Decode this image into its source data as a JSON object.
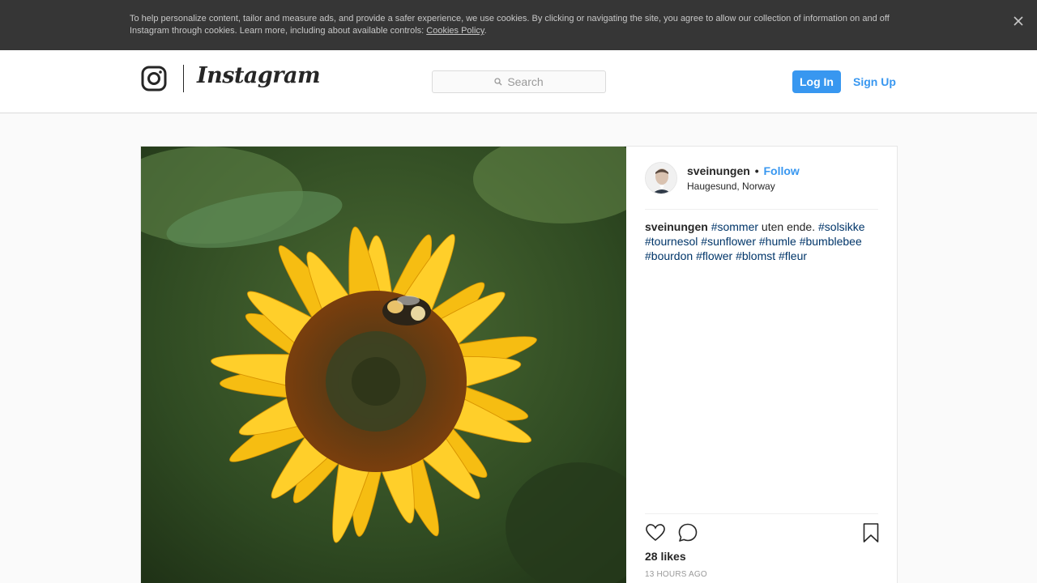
{
  "cookie_banner": {
    "text": "To help personalize content, tailor and measure ads, and provide a safer experience, we use cookies. By clicking or navigating the site, you agree to allow our collection of information on and off Instagram through cookies. Learn more, including about available controls: ",
    "link_label": "Cookies Policy",
    "link_suffix": ".",
    "close_icon": "close-icon"
  },
  "header": {
    "logo_icon": "instagram-camera-icon",
    "wordmark": "Instagram",
    "search_placeholder": "Search",
    "search_icon": "search-icon",
    "login_label": "Log In",
    "signup_label": "Sign Up"
  },
  "post": {
    "username": "sveinungen",
    "separator": "•",
    "follow_label": "Follow",
    "location": "Haugesund, Norway",
    "caption": {
      "username": "sveinungen",
      "parts": [
        {
          "type": "tag",
          "text": "#sommer"
        },
        {
          "type": "text",
          "text": " uten ende. "
        },
        {
          "type": "tag",
          "text": "#solsikke"
        },
        {
          "type": "text",
          "text": " "
        },
        {
          "type": "tag",
          "text": "#tournesol"
        },
        {
          "type": "text",
          "text": " "
        },
        {
          "type": "tag",
          "text": "#sunflower"
        },
        {
          "type": "text",
          "text": " "
        },
        {
          "type": "tag",
          "text": "#humle"
        },
        {
          "type": "text",
          "text": " "
        },
        {
          "type": "tag",
          "text": "#bumblebee"
        },
        {
          "type": "text",
          "text": " "
        },
        {
          "type": "tag",
          "text": "#bourdon"
        },
        {
          "type": "text",
          "text": " "
        },
        {
          "type": "tag",
          "text": "#flower"
        },
        {
          "type": "text",
          "text": " "
        },
        {
          "type": "tag",
          "text": "#blomst"
        },
        {
          "type": "text",
          "text": " "
        },
        {
          "type": "tag",
          "text": "#fleur"
        }
      ]
    },
    "likes": "28 likes",
    "timestamp": "13 HOURS AGO",
    "icons": [
      "heart-icon",
      "comment-icon",
      "bookmark-icon"
    ]
  },
  "colors": {
    "accent": "#3897f0",
    "hashtag": "#003569",
    "banner_bg": "#363636"
  }
}
